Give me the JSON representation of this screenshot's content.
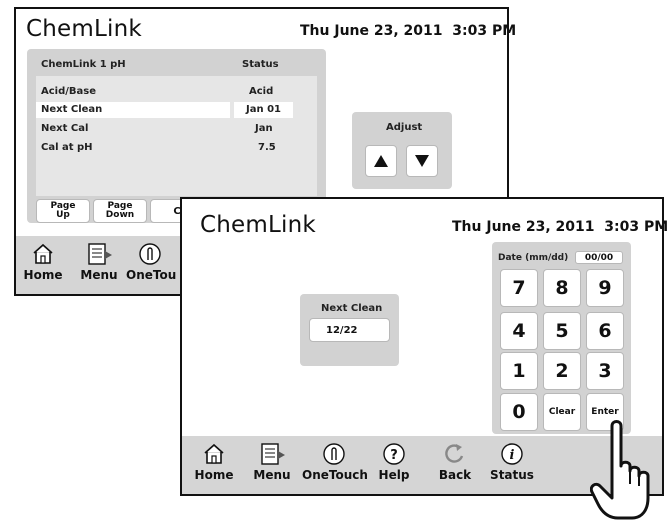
{
  "screen1": {
    "title": "ChemLink",
    "datetime": "Thu June 23, 2011  3:03 PM",
    "table": {
      "col1_header": "ChemLink 1 pH",
      "col2_header": "Status",
      "rows": [
        {
          "label": "Acid/Base",
          "value": "Acid"
        },
        {
          "label": "Next Clean",
          "value": "Jan 01"
        },
        {
          "label": "Next Cal",
          "value": "Jan"
        },
        {
          "label": "Cal at pH",
          "value": "7.5"
        }
      ]
    },
    "adjust": {
      "label": "Adjust"
    },
    "page_buttons": {
      "up": "Page Up",
      "down": "Page Down",
      "partial": "C"
    },
    "nav": {
      "home": "Home",
      "menu": "Menu",
      "onetouch": "OneTou"
    }
  },
  "screen2": {
    "title": "ChemLink",
    "datetime": "Thu June 23, 2011  3:03 PM",
    "next_clean": {
      "label": "Next Clean",
      "value": "12/22"
    },
    "keypad": {
      "date_label": "Date (mm/dd)",
      "date_value": "00/00",
      "keys": [
        "7",
        "8",
        "9",
        "4",
        "5",
        "6",
        "1",
        "2",
        "3",
        "0"
      ],
      "clear": "Clear",
      "enter": "Enter"
    },
    "nav": {
      "home": "Home",
      "menu": "Menu",
      "onetouch": "OneTouch",
      "help": "Help",
      "back": "Back",
      "status": "Status"
    }
  },
  "icons": [
    "home-icon",
    "menu-icon",
    "onetouch-icon",
    "help-icon",
    "back-icon",
    "status-icon",
    "up-arrow-icon",
    "down-arrow-icon",
    "pointing-hand-icon"
  ],
  "colors": {
    "panel": "#d2d2d2",
    "navbar": "#d5d5d5",
    "border": "#111111"
  }
}
